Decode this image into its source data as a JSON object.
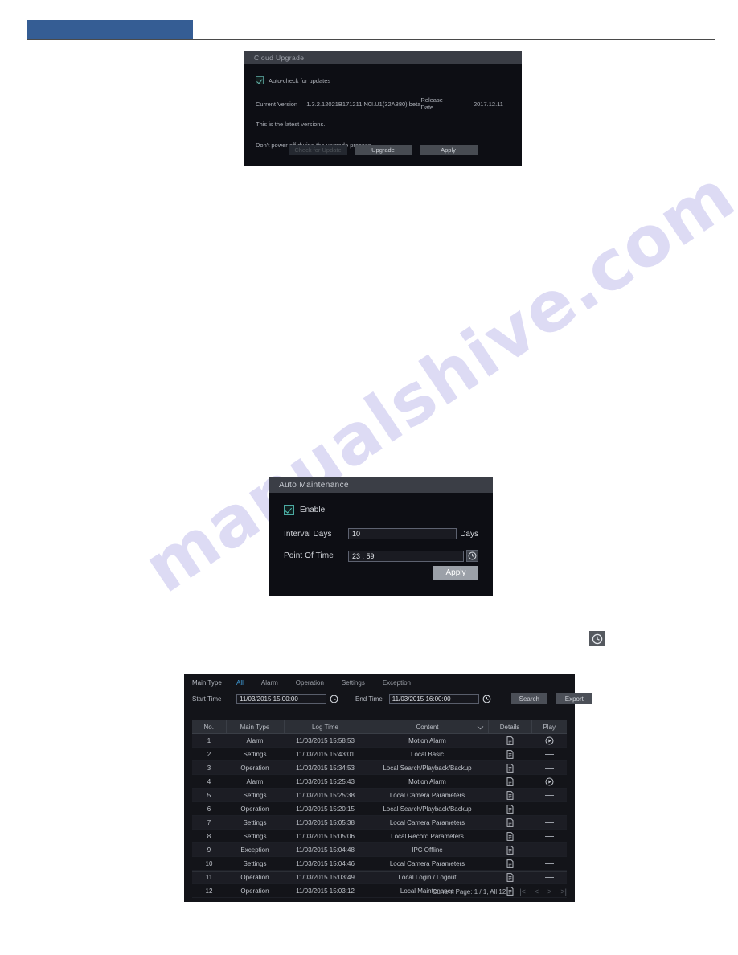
{
  "header": {
    "banner_color": "#355d94",
    "banner_label": ""
  },
  "watermark": {
    "text": "manualshive.com",
    "color": "#c9c6ee"
  },
  "cloud_upgrade": {
    "title": "Cloud Upgrade",
    "autocheck_label": "Auto-check for updates",
    "autocheck_checked": true,
    "current_version_label": "Current Version",
    "current_version_value": "1.3.2.12021B171211.N0I.U1(32A880).beta",
    "release_date_label": "Release Date",
    "release_date_value": "2017.12.11",
    "latest_version_text": "This is the latest versions.",
    "warning_text": "Don't power off during the upgrade process.",
    "buttons": {
      "check_for_update": "Check for Update",
      "upgrade": "Upgrade",
      "apply": "Apply"
    }
  },
  "auto_maintenance": {
    "title": "Auto Maintenance",
    "enable_label": "Enable",
    "enable_checked": true,
    "interval_days_label": "Interval Days",
    "interval_days_value": "10",
    "interval_days_suffix": "Days",
    "point_of_time_label": "Point Of Time",
    "point_of_time_value": "23 : 59",
    "clock_icon": "clock-icon",
    "apply_label": "Apply"
  },
  "standalone_clock": {
    "icon": "clock-icon"
  },
  "log_search": {
    "main_type_label": "Main Type",
    "type_tabs": [
      {
        "label": "All",
        "active": true
      },
      {
        "label": "Alarm",
        "active": false
      },
      {
        "label": "Operation",
        "active": false
      },
      {
        "label": "Settings",
        "active": false
      },
      {
        "label": "Exception",
        "active": false
      }
    ],
    "start_time_label": "Start Time",
    "start_time_value": "11/03/2015 15:00:00",
    "end_time_label": "End Time",
    "end_time_value": "11/03/2015 16:00:00",
    "search_label": "Search",
    "export_label": "Export",
    "columns": [
      "No.",
      "Main Type",
      "Log Time",
      "Content",
      "Details",
      "Play"
    ],
    "rows": [
      {
        "no": "1",
        "main_type": "Alarm",
        "log_time": "11/03/2015 15:58:53",
        "content": "Motion Alarm",
        "details": "document-icon",
        "play": "play-icon"
      },
      {
        "no": "2",
        "main_type": "Settings",
        "log_time": "11/03/2015 15:43:01",
        "content": "Local Basic",
        "details": "document-icon",
        "play": "dash-icon"
      },
      {
        "no": "3",
        "main_type": "Operation",
        "log_time": "11/03/2015 15:34:53",
        "content": "Local Search/Playback/Backup",
        "details": "document-icon",
        "play": "dash-icon"
      },
      {
        "no": "4",
        "main_type": "Alarm",
        "log_time": "11/03/2015 15:25:43",
        "content": "Motion Alarm",
        "details": "document-icon",
        "play": "play-icon"
      },
      {
        "no": "5",
        "main_type": "Settings",
        "log_time": "11/03/2015 15:25:38",
        "content": "Local Camera Parameters",
        "details": "document-icon",
        "play": "dash-icon"
      },
      {
        "no": "6",
        "main_type": "Operation",
        "log_time": "11/03/2015 15:20:15",
        "content": "Local Search/Playback/Backup",
        "details": "document-icon",
        "play": "dash-icon"
      },
      {
        "no": "7",
        "main_type": "Settings",
        "log_time": "11/03/2015 15:05:38",
        "content": "Local Camera Parameters",
        "details": "document-icon",
        "play": "dash-icon"
      },
      {
        "no": "8",
        "main_type": "Settings",
        "log_time": "11/03/2015 15:05:06",
        "content": "Local Record Parameters",
        "details": "document-icon",
        "play": "dash-icon"
      },
      {
        "no": "9",
        "main_type": "Exception",
        "log_time": "11/03/2015 15:04:48",
        "content": "IPC Offline",
        "details": "document-icon",
        "play": "dash-icon"
      },
      {
        "no": "10",
        "main_type": "Settings",
        "log_time": "11/03/2015 15:04:46",
        "content": "Local Camera Parameters",
        "details": "document-icon",
        "play": "dash-icon"
      },
      {
        "no": "11",
        "main_type": "Operation",
        "log_time": "11/03/2015 15:03:49",
        "content": "Local Login / Logout",
        "details": "document-icon",
        "play": "dash-icon"
      },
      {
        "no": "12",
        "main_type": "Operation",
        "log_time": "11/03/2015 15:03:12",
        "content": "Local Maintenance",
        "details": "document-icon",
        "play": "dash-icon"
      }
    ],
    "page_status": "Current Page: 1 / 1, All 12",
    "pager": {
      "first": "|<",
      "prev": "<",
      "next": ">",
      "last": ">|"
    }
  }
}
